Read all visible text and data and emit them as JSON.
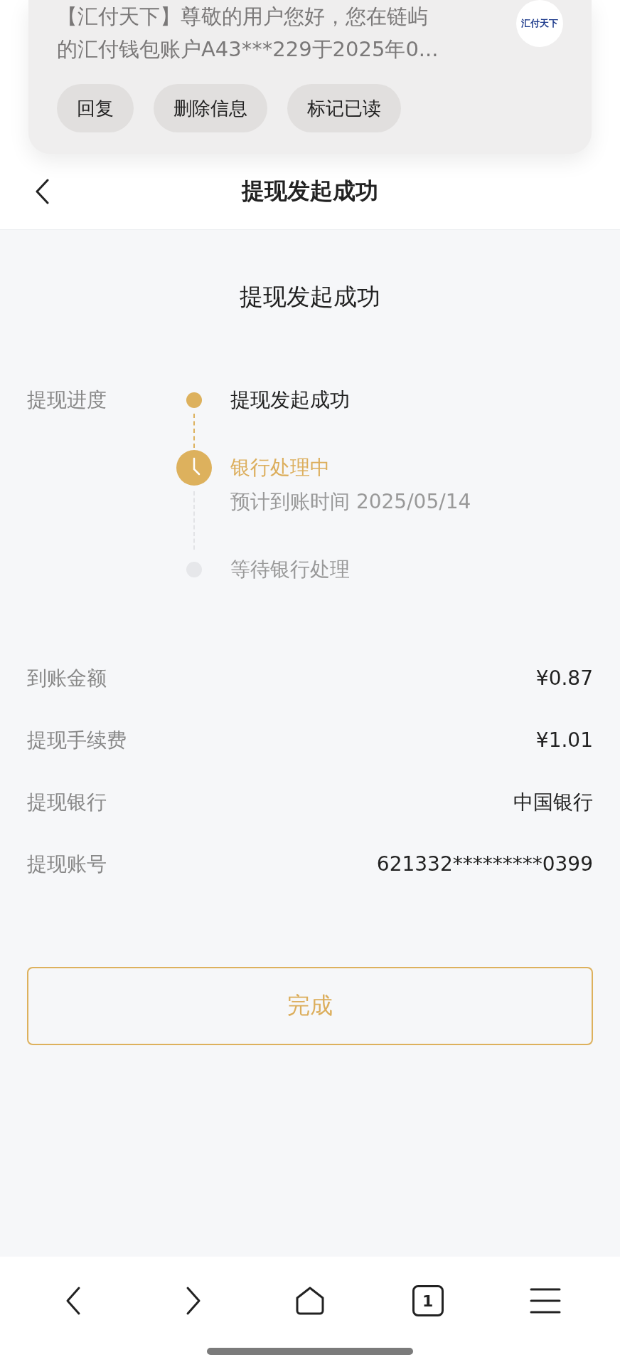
{
  "notification": {
    "lines": [
      "【汇付天下】尊敬的用户您好，您在链屿",
      "的汇付钱包账户A43***229于2025年0..."
    ],
    "logo": "汇付天下",
    "actions": [
      "回复",
      "删除信息",
      "标记已读"
    ]
  },
  "header": {
    "title": "提现发起成功"
  },
  "heading": "提现发起成功",
  "progress": {
    "label": "提现进度",
    "steps": [
      {
        "kind": "done",
        "title": "提现发起成功"
      },
      {
        "kind": "active",
        "title": "银行处理中",
        "note": "预计到账时间 2025/05/14"
      },
      {
        "kind": "pending",
        "title": "等待银行处理"
      }
    ]
  },
  "details": [
    {
      "label": "到账金额",
      "value": "¥0.87"
    },
    {
      "label": "提现手续费",
      "value": "¥1.01"
    },
    {
      "label": "提现银行",
      "value": "中国银行"
    },
    {
      "label": "提现账号",
      "value": "621332*********0399"
    }
  ],
  "done_button": "完成",
  "browser_bar": {
    "tab_count": "1"
  }
}
